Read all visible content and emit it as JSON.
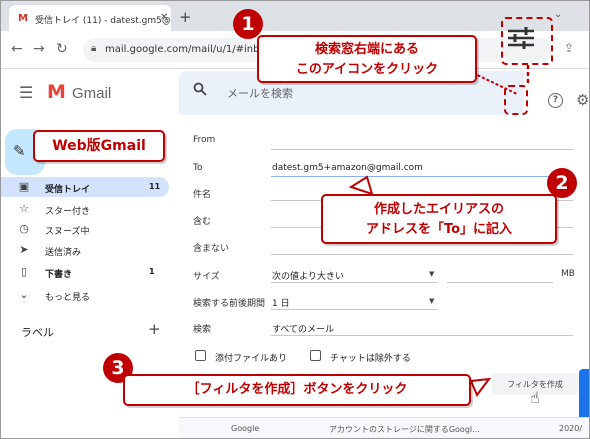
{
  "browser": {
    "tab_title": "受信トレイ (11) - datest.gm5@gm",
    "tab_favicon": "M",
    "url": "mail.google.com/mail/u/1/#inbox"
  },
  "gmail": {
    "brand": "Gmail",
    "search_placeholder": "メールを検索"
  },
  "sidebar": {
    "items": [
      {
        "icon": "inbox-icon",
        "label": "受信トレイ",
        "count": "11",
        "active": true
      },
      {
        "icon": "star-icon",
        "label": "スター付き",
        "count": ""
      },
      {
        "icon": "clock-icon",
        "label": "スヌーズ中",
        "count": ""
      },
      {
        "icon": "send-icon",
        "label": "送信済み",
        "count": ""
      },
      {
        "icon": "draft-icon",
        "label": "下書き",
        "count": "1"
      },
      {
        "icon": "chevron-down-icon",
        "label": "もっと見る",
        "count": ""
      }
    ],
    "labels_title": "ラベル",
    "labels_add": "+"
  },
  "filter": {
    "from_label": "From",
    "to_label": "To",
    "to_value": "datest.gm5+amazon@gmail.com",
    "subject_label": "件名",
    "has_words_label": "含む",
    "doesnt_have_label": "含まない",
    "size_label": "サイズ",
    "size_op": "次の値より大きい",
    "size_unit": "MB",
    "date_label": "検索する前後期間",
    "date_value": "1 日",
    "search_label": "検索",
    "search_value": "すべてのメール",
    "has_attachment": "添付ファイルあり",
    "exclude_chats": "チャットは除外する",
    "create_button": "フィルタを作成"
  },
  "bottom_row": {
    "sender": "Google",
    "subject": "アカウントのストレージに関するGoogl...",
    "date": "2020/"
  },
  "annotations": {
    "step1_number": "1",
    "step1_line1": "検索窓右端にある",
    "step1_line2": "このアイコンをクリック",
    "web_gmail_label": "Web版Gmail",
    "step2_number": "2",
    "step2_line1": "作成したエイリアスの",
    "step2_line2": "アドレスを「To」に記入",
    "step3_number": "3",
    "step3_text": "［フィルタを作成］ボタンをクリック",
    "accent_color": "#c00000"
  }
}
